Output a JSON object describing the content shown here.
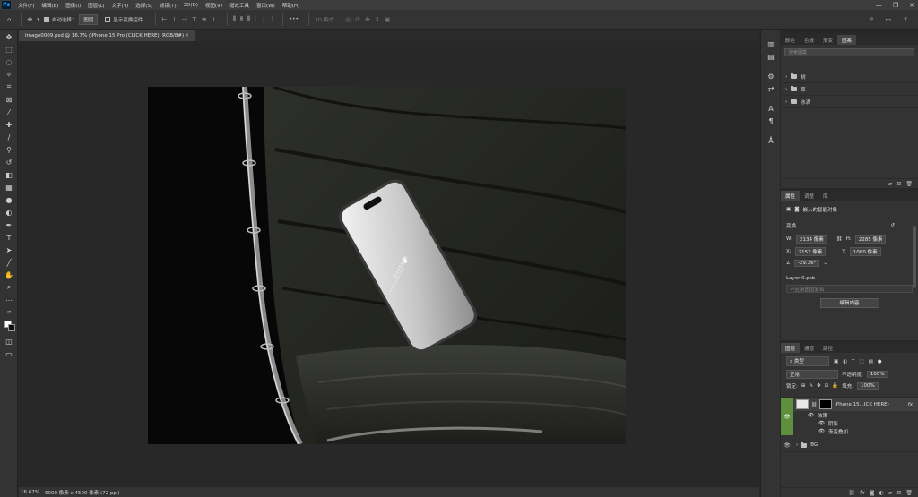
{
  "app": {
    "logo": "Ps",
    "menu": [
      "文件(F)",
      "编辑(E)",
      "图像(I)",
      "图层(L)",
      "文字(Y)",
      "选择(S)",
      "滤镜(T)",
      "3D(D)",
      "视图(V)",
      "增效工具",
      "窗口(W)",
      "帮助(H)"
    ],
    "window_controls": [
      "—",
      "❐",
      "✕"
    ]
  },
  "options_bar": {
    "auto_select_label": "自动选择：",
    "auto_select_value": "图层",
    "show_transform_label": "显示变换控件",
    "mode_label": "3D 模式：",
    "more_glyph": "•••"
  },
  "document": {
    "tab_title": "Image0009.psd @ 16.7% (iPhone 15 Pro (CLICK HERE), RGB/8#)",
    "close_glyph": "×",
    "phone_brand": "MANENTO",
    "phone_tagline": "MODERN DESIGN STUDIO"
  },
  "status": {
    "zoom": "16.67%",
    "dimensions": "6000 像素 x 4500 像素 (72 ppi)",
    "arrow": "›"
  },
  "swatches_panel": {
    "tabs": [
      "颜色",
      "色板",
      "渐变",
      "图案"
    ],
    "active_tab": 3,
    "search_placeholder": "搜索图案",
    "groups": [
      "树",
      "草",
      "水滴"
    ]
  },
  "properties_panel": {
    "tabs": [
      "属性",
      "调整",
      "库"
    ],
    "active_tab": 0,
    "object_type": "嵌入的智能对象",
    "transform_label": "变换",
    "w_label": "W:",
    "w_value": "2134 像素",
    "h_label": "H:",
    "h_value": "2285 像素",
    "x_label": "X:",
    "x_value": "2153 像素",
    "y_label": "Y:",
    "y_value": "1080 像素",
    "angle_value": "-29.36°",
    "file_name": "Layer 0.psb",
    "comp_placeholder": "不应用图层复合",
    "edit_button": "编辑内容"
  },
  "layers_panel": {
    "tabs": [
      "图层",
      "通道",
      "路径"
    ],
    "active_tab": 0,
    "filter_label": "类型",
    "blend_mode": "正常",
    "opacity_label": "不透明度:",
    "opacity_value": "100%",
    "lock_label": "锁定:",
    "fill_label": "填充:",
    "fill_value": "100%",
    "layers": [
      {
        "name": "iPhone 15...ICK HERE)",
        "fx": "fx"
      },
      {
        "name": "效果"
      },
      {
        "name": "阴影"
      },
      {
        "name": "渐变叠加"
      },
      {
        "name": "BG"
      }
    ],
    "accent_color": "#5f8f3c"
  }
}
